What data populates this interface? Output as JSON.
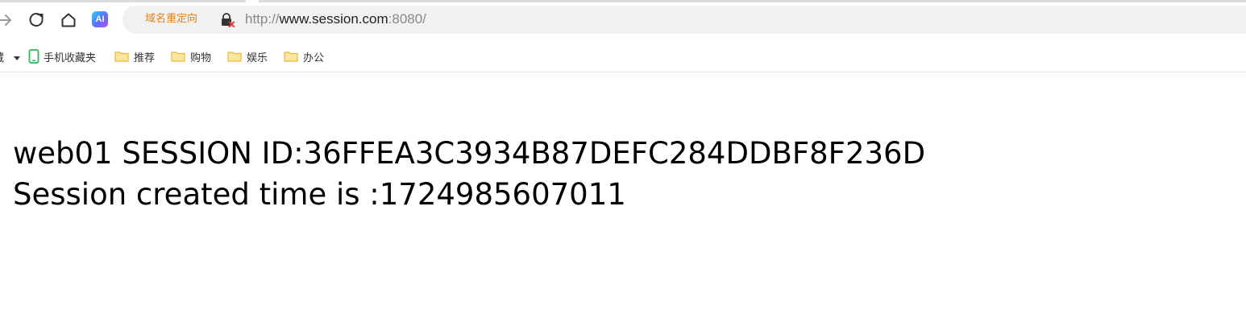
{
  "toolbar": {
    "redirect_label": "域名重定向",
    "ai_label": "AI",
    "url": {
      "scheme": "http://",
      "host": "www.session.com",
      "rest": ":8080/"
    }
  },
  "bookmarks": {
    "partial_left": "藏",
    "mobile_label": "手机收藏夹",
    "folders": [
      "推荐",
      "购物",
      "娱乐",
      "办公"
    ]
  },
  "page": {
    "line1": "web01 SESSION ID:36FFEA3C3934B87DEFC284DDBF8F236D",
    "line2": "Session created time is :1724985607011"
  },
  "colors": {
    "redirect_tag": "#e8841a",
    "folder": "#f5c842",
    "mobile_icon": "#2fb55a",
    "lock_warning": "#e53935"
  }
}
